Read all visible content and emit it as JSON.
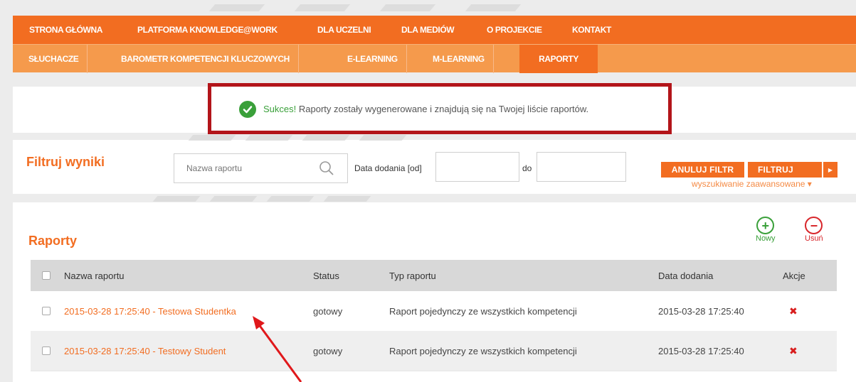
{
  "topnav": {
    "items": [
      "STRONA GŁÓWNA",
      "PLATFORMA KNOWLEDGE@WORK",
      "DLA UCZELNI",
      "DLA MEDIÓW",
      "O PROJEKCIE",
      "KONTAKT"
    ]
  },
  "subnav": {
    "items": [
      "SŁUCHACZE",
      "BAROMETR KOMPETENCJI KLUCZOWYCH",
      "E-LEARNING",
      "M-LEARNING",
      "RAPORTY"
    ],
    "active": "RAPORTY"
  },
  "alert": {
    "prefix": "Sukces!",
    "message": " Raporty zostały wygenerowane i znajdują się na Twojej liście raportów."
  },
  "filter": {
    "title": "Filtruj wyniki",
    "name_placeholder": "Nazwa raportu",
    "date_from_label": "Data dodania [od]",
    "date_to_label": "do",
    "date_from_value": "",
    "date_to_value": "",
    "cancel_label": "ANULUJ FILTR",
    "filter_label": "FILTRUJ",
    "advanced_label": "wyszukiwanie zaawansowane ▾"
  },
  "reports": {
    "title": "Raporty",
    "new_label": "Nowy",
    "delete_label": "Usuń",
    "columns": [
      "Nazwa raportu",
      "Status",
      "Typ raportu",
      "Data dodania",
      "Akcje"
    ],
    "rows": [
      {
        "name": "2015-03-28 17:25:40 - Testowa Studentka",
        "status": "gotowy",
        "type": "Raport pojedynczy ze wszystkich kompetencji",
        "date": "2015-03-28 17:25:40"
      },
      {
        "name": "2015-03-28 17:25:40 - Testowy Student",
        "status": "gotowy",
        "type": "Raport pojedynczy ze wszystkich kompetencji",
        "date": "2015-03-28 17:25:40"
      }
    ]
  },
  "colors": {
    "primary_orange": "#f26d21",
    "light_orange": "#f59a4c",
    "success_green": "#3aa03a",
    "highlight_red": "#b3151a"
  }
}
